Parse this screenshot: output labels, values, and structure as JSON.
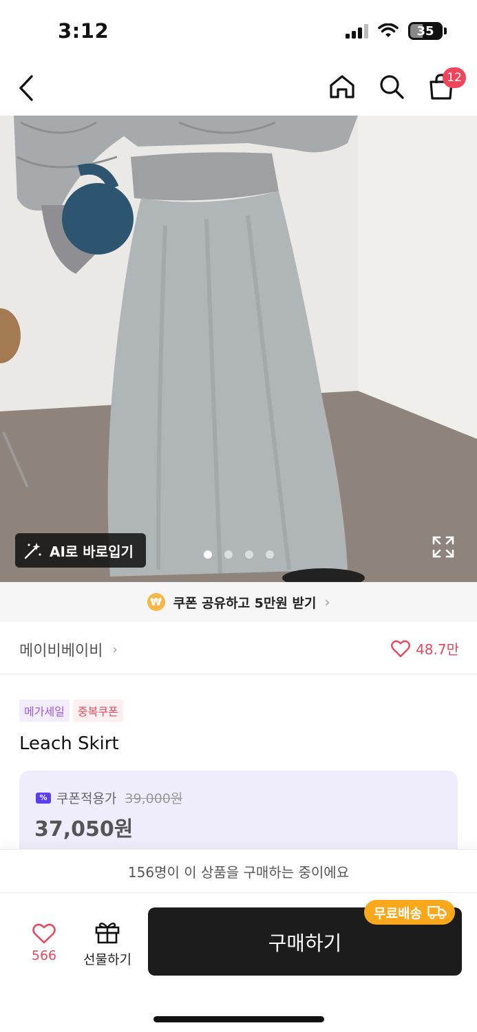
{
  "status_bar": {
    "time": "3:12",
    "battery": "35"
  },
  "nav": {
    "cart_count": "12"
  },
  "hero": {
    "ai_try_on_label": "AI로 바로입기",
    "slide_count": 4,
    "active_slide": 1
  },
  "coupon_banner": {
    "coin_symbol": "₩",
    "text": "쿠폰 공유하고 5만원 받기",
    "chevron": "›"
  },
  "brand": {
    "name": "메이비베이비",
    "chevron": "›",
    "likes": "48.7만"
  },
  "product": {
    "tags": [
      "메가세일",
      "중복쿠폰"
    ],
    "title": "Leach Skirt"
  },
  "price": {
    "coupon_icon_text": "%",
    "coupon_label": "쿠폰적용가",
    "original_price": "39,000원",
    "final_price": "37,050원"
  },
  "notice": {
    "text": "156명이 이 상품을 구매하는 중이에요"
  },
  "bottom_bar": {
    "wish_count": "566",
    "gift_label": "선물하기",
    "buy_label": "구매하기",
    "free_shipping_label": "무료배송"
  },
  "colors": {
    "accent_pink": "#e8485e",
    "badge_red": "#f0455b",
    "free_ship_orange": "#f9a81b",
    "price_box_bg": "#efedfc",
    "buy_button_bg": "#1c1c1c"
  },
  "icons": [
    "back-icon",
    "home-icon",
    "search-icon",
    "cart-icon",
    "sparkle-icon",
    "expand-icon",
    "heart-icon",
    "gift-icon",
    "truck-icon",
    "coupon-icon"
  ]
}
